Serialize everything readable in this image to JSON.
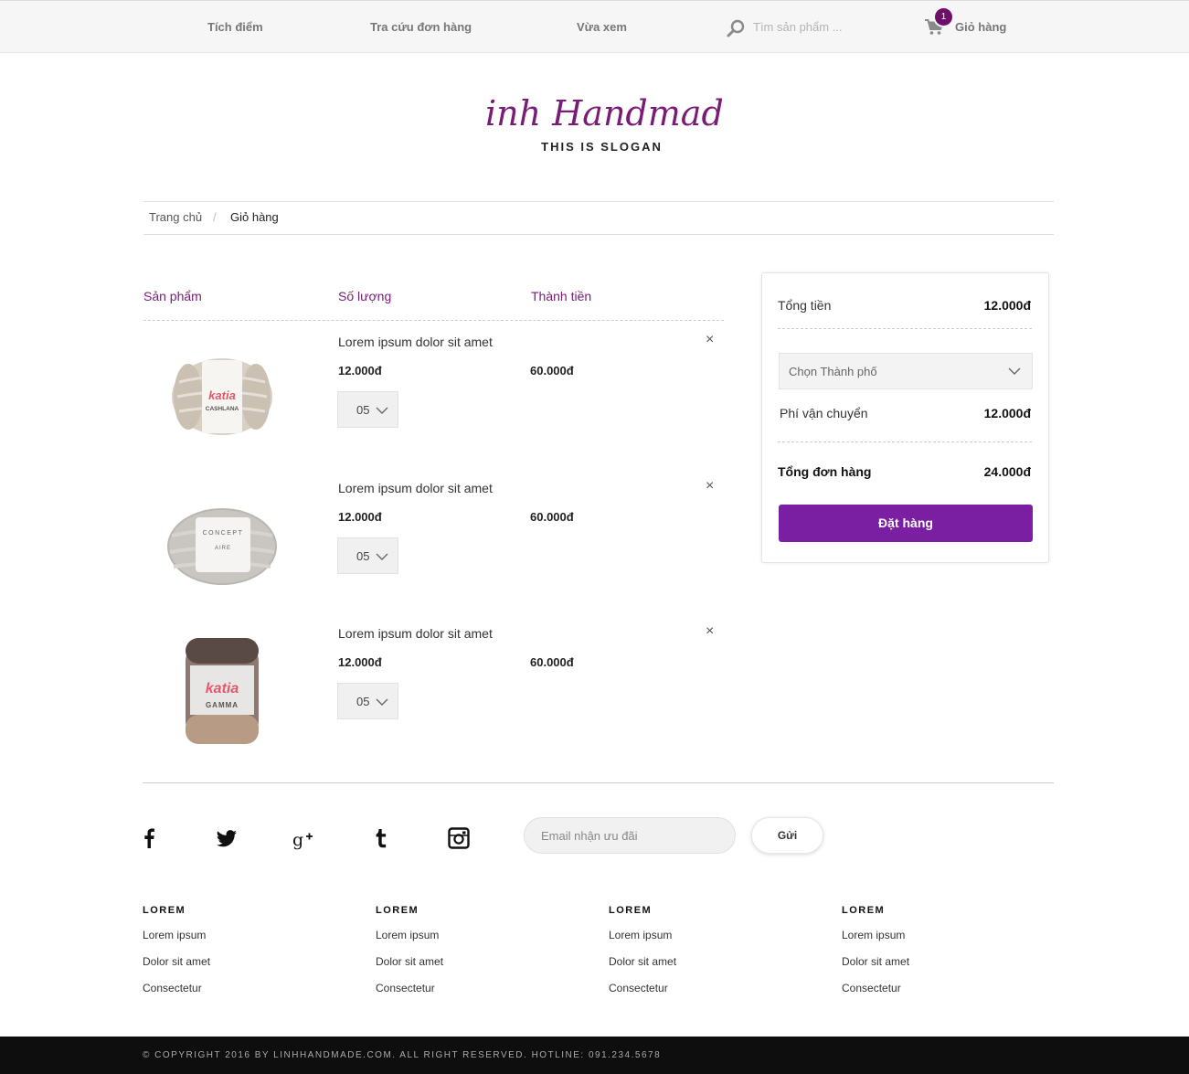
{
  "topbar": {
    "points": "Tích điểm",
    "order_lookup": "Tra cứu đơn hàng",
    "recently_viewed": "Vừa xem",
    "search_placeholder": "Tìm sản phẩm ...",
    "cart_count": "1",
    "cart_label": "Giỏ hàng"
  },
  "brand": {
    "name": "Linh Handmade",
    "slogan": "THIS IS SLOGAN",
    "color": "#7a1b78"
  },
  "breadcrumb": {
    "home": "Trang chủ",
    "separator": "/",
    "current": "Giỏ hàng"
  },
  "cart": {
    "headers": {
      "product": "Sản phẩm",
      "quantity": "Số lượng",
      "subtotal": "Thành tiền"
    },
    "items": [
      {
        "name": "Lorem ipsum dolor sit amet",
        "price": "12.000đ",
        "total": "60.000đ",
        "qty": "05",
        "image": "yarn-ball-cream-cashlana"
      },
      {
        "name": "Lorem ipsum dolor sit amet",
        "price": "12.000đ",
        "total": "60.000đ",
        "qty": "05",
        "image": "yarn-ball-grey-aire"
      },
      {
        "name": "Lorem ipsum dolor sit amet",
        "price": "12.000đ",
        "total": "60.000đ",
        "qty": "05",
        "image": "yarn-skein-brown-gamma"
      }
    ],
    "remove_symbol": "×",
    "image_labels": [
      "katia",
      "CASHLANA",
      "CONCEPT",
      "AIRE",
      "katia",
      "GAMMA"
    ]
  },
  "summary": {
    "total_label": "Tổng tiền",
    "total_value": "12.000đ",
    "city_placeholder": "Chọn Thành phố",
    "shipping_label": "Phí vận chuyển",
    "shipping_value": "12.000đ",
    "order_total_label": "Tổng đơn hàng",
    "order_total_value": "24.000đ",
    "order_button": "Đặt hàng",
    "button_color": "#7b1fa2"
  },
  "social": {
    "icons": [
      "facebook-icon",
      "twitter-icon",
      "google-plus-icon",
      "tumblr-icon",
      "instagram-icon"
    ],
    "email_placeholder": "Email nhận ưu đãi",
    "send_label": "Gửi"
  },
  "footer_columns": [
    {
      "title": "LOREM",
      "links": [
        "Lorem ipsum",
        "Dolor sit amet",
        "Consectetur"
      ]
    },
    {
      "title": "LOREM",
      "links": [
        "Lorem ipsum",
        "Dolor sit amet",
        "Consectetur"
      ]
    },
    {
      "title": "LOREM",
      "links": [
        "Lorem ipsum",
        "Dolor sit amet",
        "Consectetur"
      ]
    },
    {
      "title": "LOREM",
      "links": [
        "Lorem ipsum",
        "Dolor sit amet",
        "Consectetur"
      ]
    }
  ],
  "copyright": "© COPYRIGHT 2016 BY LINHHANDMADE.COM. ALL RIGHT RESERVED. HOTLINE: 091.234.5678"
}
